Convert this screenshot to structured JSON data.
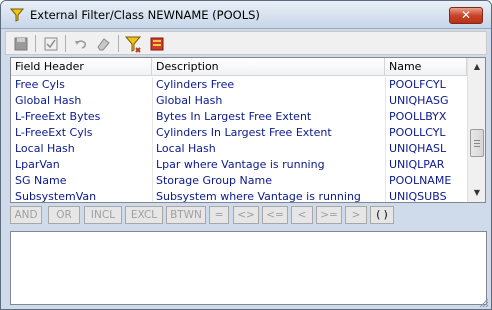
{
  "window": {
    "title": "External Filter/Class NEWNAME (POOLS)",
    "close_label": "✕"
  },
  "toolbar": {
    "buttons": [
      "save-icon",
      "check-filter-icon",
      "undo-icon",
      "eraser-icon",
      "filter-icon",
      "book-icon"
    ]
  },
  "grid": {
    "columns": [
      "Field Header",
      "Description",
      "Name"
    ],
    "rows": [
      {
        "field": "Free Cyls",
        "description": "Cylinders Free",
        "name": "POOLFCYL"
      },
      {
        "field": "Global Hash",
        "description": "Global Hash",
        "name": "UNIQHASG"
      },
      {
        "field": "L-FreeExt Bytes",
        "description": "Bytes In Largest Free Extent",
        "name": "POOLLBYX"
      },
      {
        "field": "L-FreeExt Cyls",
        "description": "Cylinders In Largest Free Extent",
        "name": "POOLLCYL"
      },
      {
        "field": "Local Hash",
        "description": "Local Hash",
        "name": "UNIQHASL"
      },
      {
        "field": "LparVan",
        "description": "Lpar where Vantage is running",
        "name": "UNIQLPAR"
      },
      {
        "field": "SG Name",
        "description": "Storage Group Name",
        "name": "POOLNAME"
      },
      {
        "field": "SubsystemVan",
        "description": "Subsystem where Vantage is running",
        "name": "UNIQSUBS"
      }
    ]
  },
  "operators": [
    {
      "label": "AND",
      "enabled": false
    },
    {
      "label": "OR",
      "enabled": false
    },
    {
      "label": "INCL",
      "enabled": false
    },
    {
      "label": "EXCL",
      "enabled": false
    },
    {
      "label": "BTWN",
      "enabled": false
    },
    {
      "label": "=",
      "enabled": false
    },
    {
      "label": "<>",
      "enabled": false
    },
    {
      "label": "<=",
      "enabled": false
    },
    {
      "label": "<",
      "enabled": false
    },
    {
      "label": ">=",
      "enabled": false
    },
    {
      "label": ">",
      "enabled": false
    },
    {
      "label": "( )",
      "enabled": true
    }
  ],
  "expression": {
    "value": ""
  },
  "colors": {
    "row_text": "#0b1a8c",
    "titlebar": "#c7d6e8",
    "close_button": "#c8432a"
  }
}
